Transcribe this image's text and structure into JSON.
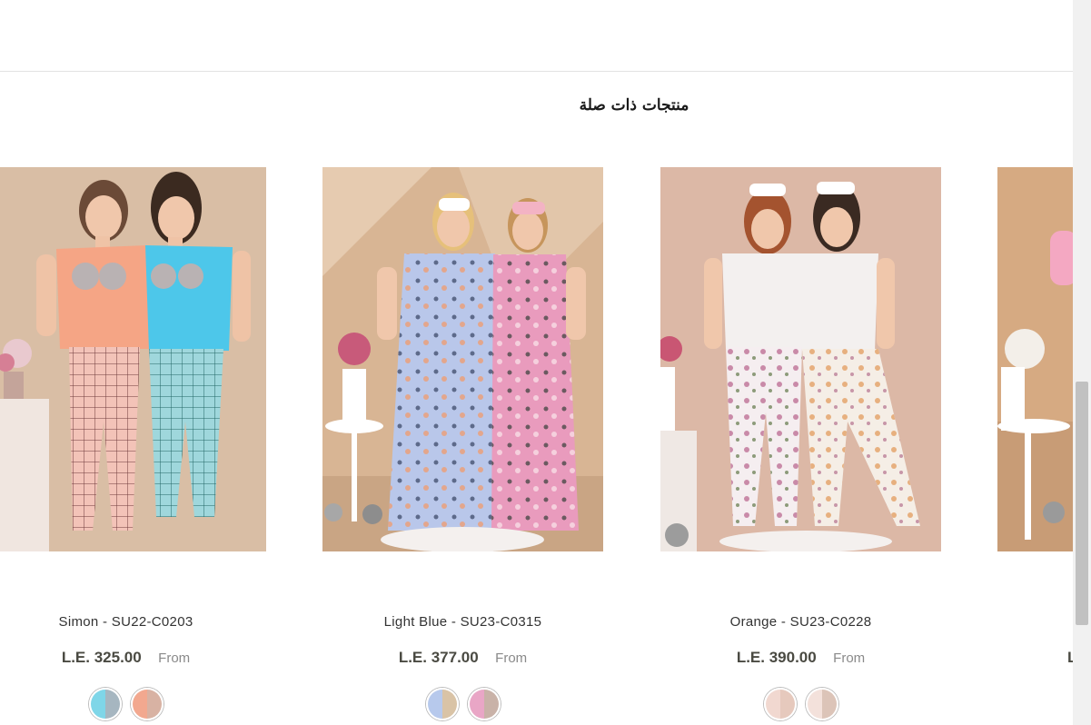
{
  "section": {
    "title": "منتجات ذات صلة"
  },
  "products": [
    {
      "name": "Simon - SU22-C0203",
      "price": "L.E. 325.00",
      "from_label": "From",
      "swatches": [
        [
          "#7fd6e8",
          "#a6b6c0"
        ],
        [
          "#f2a88f",
          "#d8b2a3"
        ]
      ]
    },
    {
      "name": "Light Blue - SU23-C0315",
      "price": "L.E. 377.00",
      "from_label": "From",
      "swatches": [
        [
          "#b7c9ec",
          "#d9c3a6"
        ],
        [
          "#e9a6c6",
          "#c9b2a8"
        ]
      ]
    },
    {
      "name": "Orange - SU23-C0228",
      "price": "L.E. 390.00",
      "from_label": "From",
      "swatches": [
        [
          "#f1d8d0",
          "#e6c9bd"
        ],
        [
          "#f3e1db",
          "#dcc4b8"
        ]
      ]
    }
  ],
  "partial_product": {
    "price_initial": "L"
  },
  "colors": {
    "accent_price": "#4a4a42",
    "photo_background": "#d9b99e"
  }
}
